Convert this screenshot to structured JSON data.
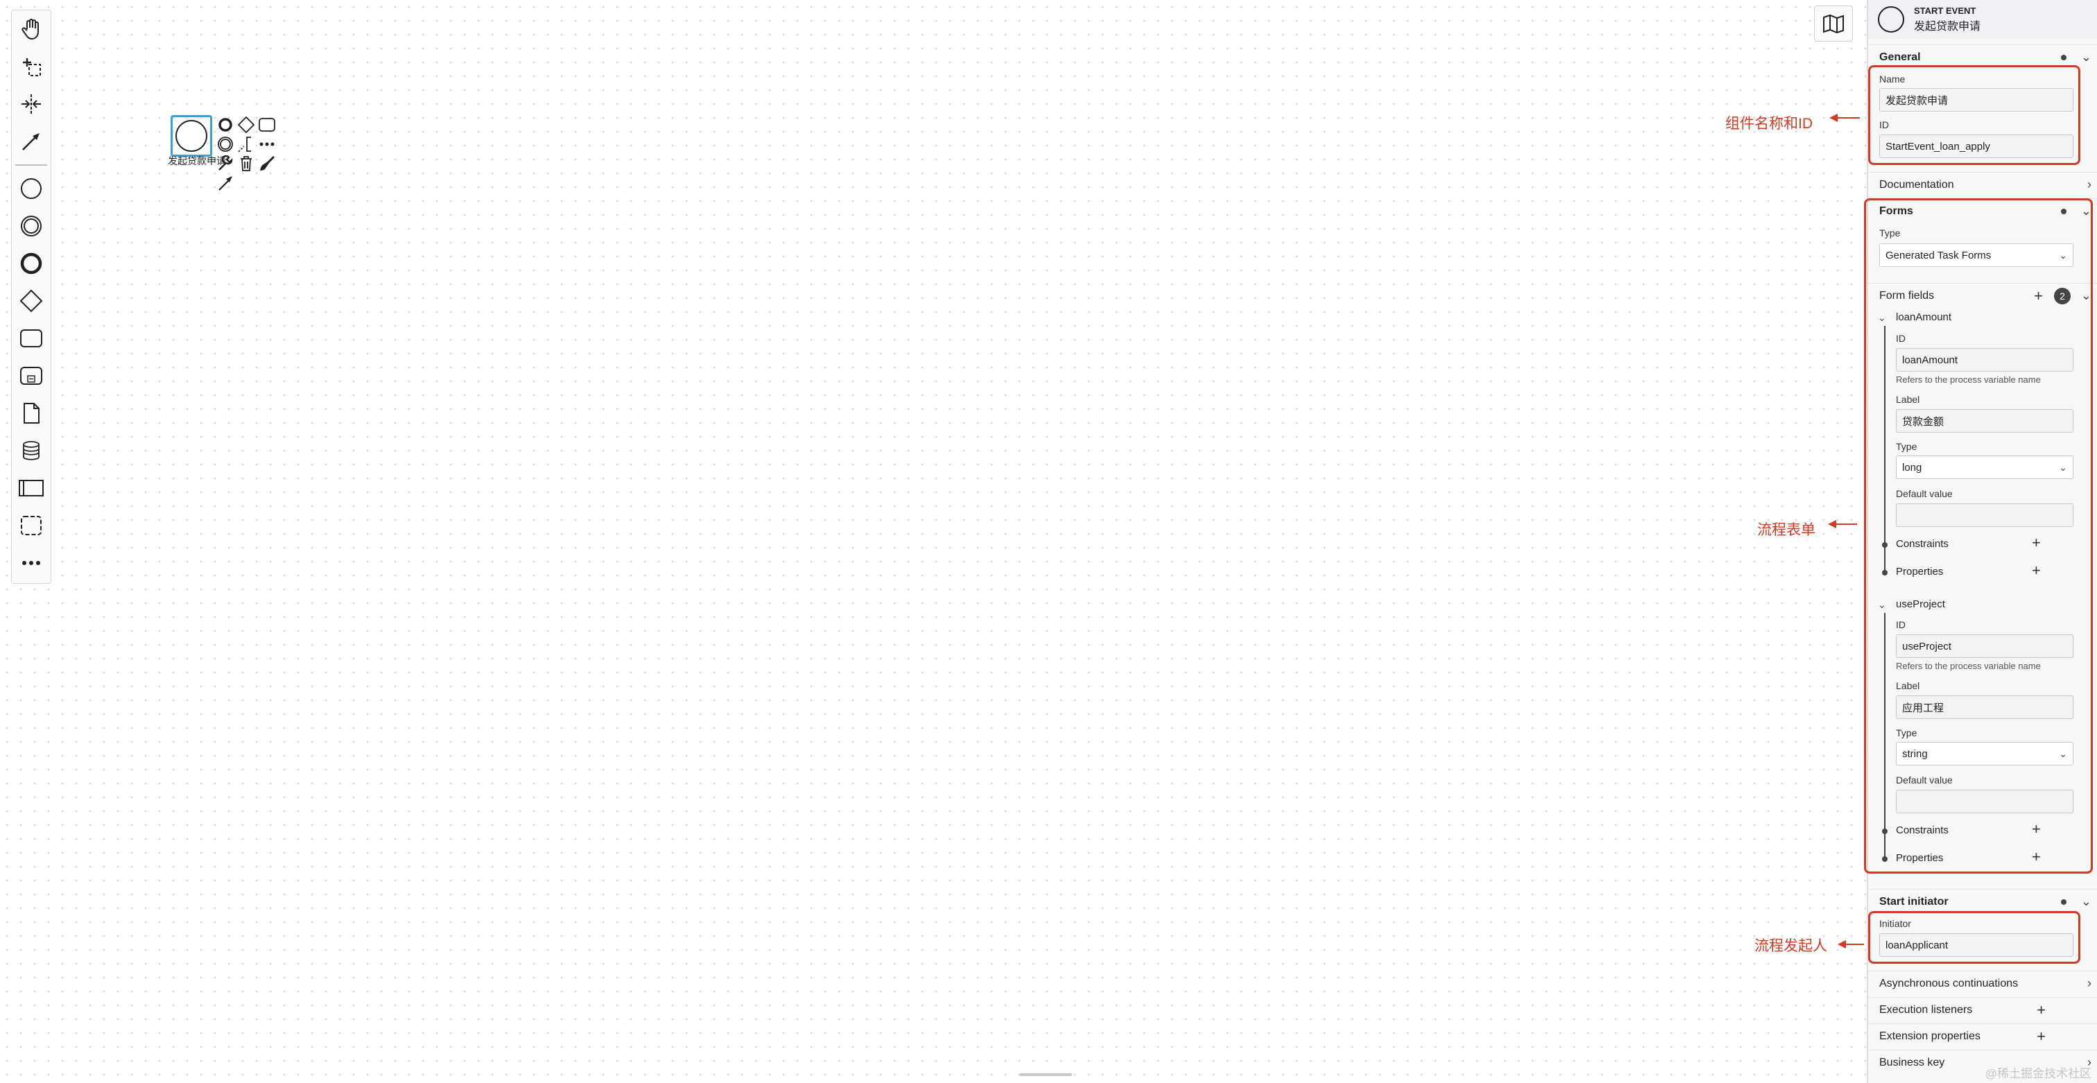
{
  "palette": {
    "tools": [
      "hand-tool",
      "lasso-tool",
      "space-tool",
      "global-connect-tool",
      "start-event",
      "intermediate-event",
      "end-event",
      "gateway",
      "task",
      "subprocess",
      "data-object",
      "data-store",
      "pool",
      "group",
      "more"
    ]
  },
  "diagram": {
    "start_event_label": "发起贷款申请"
  },
  "annotations": {
    "name_id": "组件名称和ID",
    "form": "流程表单",
    "initiator": "流程发起人"
  },
  "panel": {
    "header": {
      "type": "START EVENT",
      "name": "发起贷款申请"
    },
    "general": {
      "title": "General",
      "name_label": "Name",
      "name_value": "发起贷款申请",
      "id_label": "ID",
      "id_value": "StartEvent_loan_apply"
    },
    "documentation": {
      "title": "Documentation"
    },
    "forms": {
      "title": "Forms",
      "type_label": "Type",
      "type_value": "Generated Task Forms"
    },
    "form_fields": {
      "title": "Form fields",
      "count": "2",
      "fields": [
        {
          "name": "loanAmount",
          "id_label": "ID",
          "id_value": "loanAmount",
          "id_hint": "Refers to the process variable name",
          "label_label": "Label",
          "label_value": "贷款金额",
          "type_label": "Type",
          "type_value": "long",
          "default_label": "Default value",
          "default_value": "",
          "constraints": "Constraints",
          "properties": "Properties"
        },
        {
          "name": "useProject",
          "id_label": "ID",
          "id_value": "useProject",
          "id_hint": "Refers to the process variable name",
          "label_label": "Label",
          "label_value": "应用工程",
          "type_label": "Type",
          "type_value": "string",
          "default_label": "Default value",
          "default_value": "",
          "constraints": "Constraints",
          "properties": "Properties"
        }
      ]
    },
    "start_initiator": {
      "title": "Start initiator",
      "initiator_label": "Initiator",
      "initiator_value": "loanApplicant"
    },
    "async": {
      "title": "Asynchronous continuations"
    },
    "exec_listeners": {
      "title": "Execution listeners"
    },
    "ext_properties": {
      "title": "Extension properties"
    },
    "business_key": {
      "title": "Business key"
    }
  },
  "watermark": "@稀土掘金技术社区",
  "colors": {
    "annotation": "#d43a22",
    "selection": "#3aa0dc"
  }
}
